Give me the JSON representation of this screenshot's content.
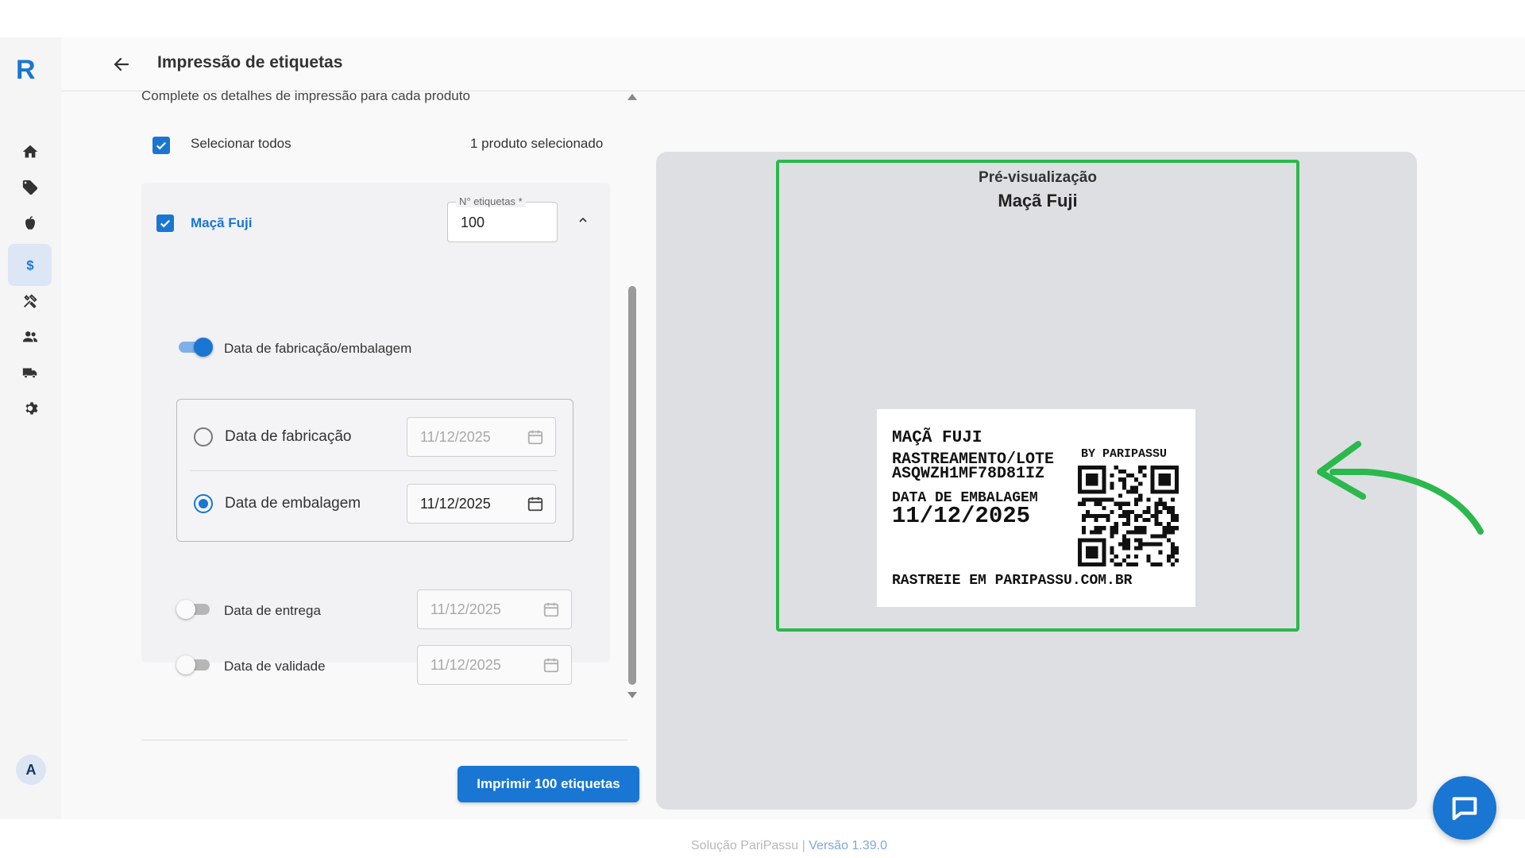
{
  "app": {
    "logo": "R",
    "avatar_initial": "A"
  },
  "header": {
    "title": "Impressão de etiquetas"
  },
  "panel": {
    "subtitle": "Complete os detalhes de impressão para cada produto",
    "select_all_label": "Selecionar todos",
    "selected_count": "1 produto selecionado"
  },
  "product": {
    "name": "Maçã Fuji",
    "qty_label": "N° etiquetas *",
    "qty_value": "100",
    "manufacture_toggle_label": "Data de fabricação/embalagem",
    "manufacture_toggle_on": true,
    "radio_fabricacao_label": "Data de fabricação",
    "radio_fabricacao_date": "11/12/2025",
    "radio_embalagem_label": "Data de embalagem",
    "radio_embalagem_date": "11/12/2025",
    "selected_radio": "embalagem",
    "entrega_label": "Data de entrega",
    "entrega_date": "11/12/2025",
    "validade_label": "Data de validade",
    "validade_date": "11/12/2025"
  },
  "print_button": "Imprimir 100 etiquetas",
  "preview": {
    "title": "Pré-visualização",
    "product": "Maçã Fuji",
    "label": {
      "name": "MAÇÃ FUJI",
      "tracking_title": "RASTREAMENTO/LOTE",
      "tracking_code": "ASQWZH1MF78D81IZ",
      "by": "BY PARIPASSU",
      "date_title": "DATA DE EMBALAGEM",
      "date_value": "11/12/2025",
      "footer": "RASTREIE EM PARIPASSU.COM.BR"
    }
  },
  "footer": {
    "text": "Solução PariPassu |",
    "version": "Versão 1.39.0"
  },
  "colors": {
    "primary": "#1976d2",
    "highlight_green": "#2bb84c"
  },
  "sidebar": {
    "items": [
      {
        "icon": "home-icon"
      },
      {
        "icon": "tag-icon"
      },
      {
        "icon": "apple-icon"
      },
      {
        "icon": "dollar-icon",
        "active": true
      },
      {
        "icon": "tools-icon"
      },
      {
        "icon": "users-icon"
      },
      {
        "icon": "truck-icon"
      },
      {
        "icon": "gear-icon"
      }
    ]
  }
}
